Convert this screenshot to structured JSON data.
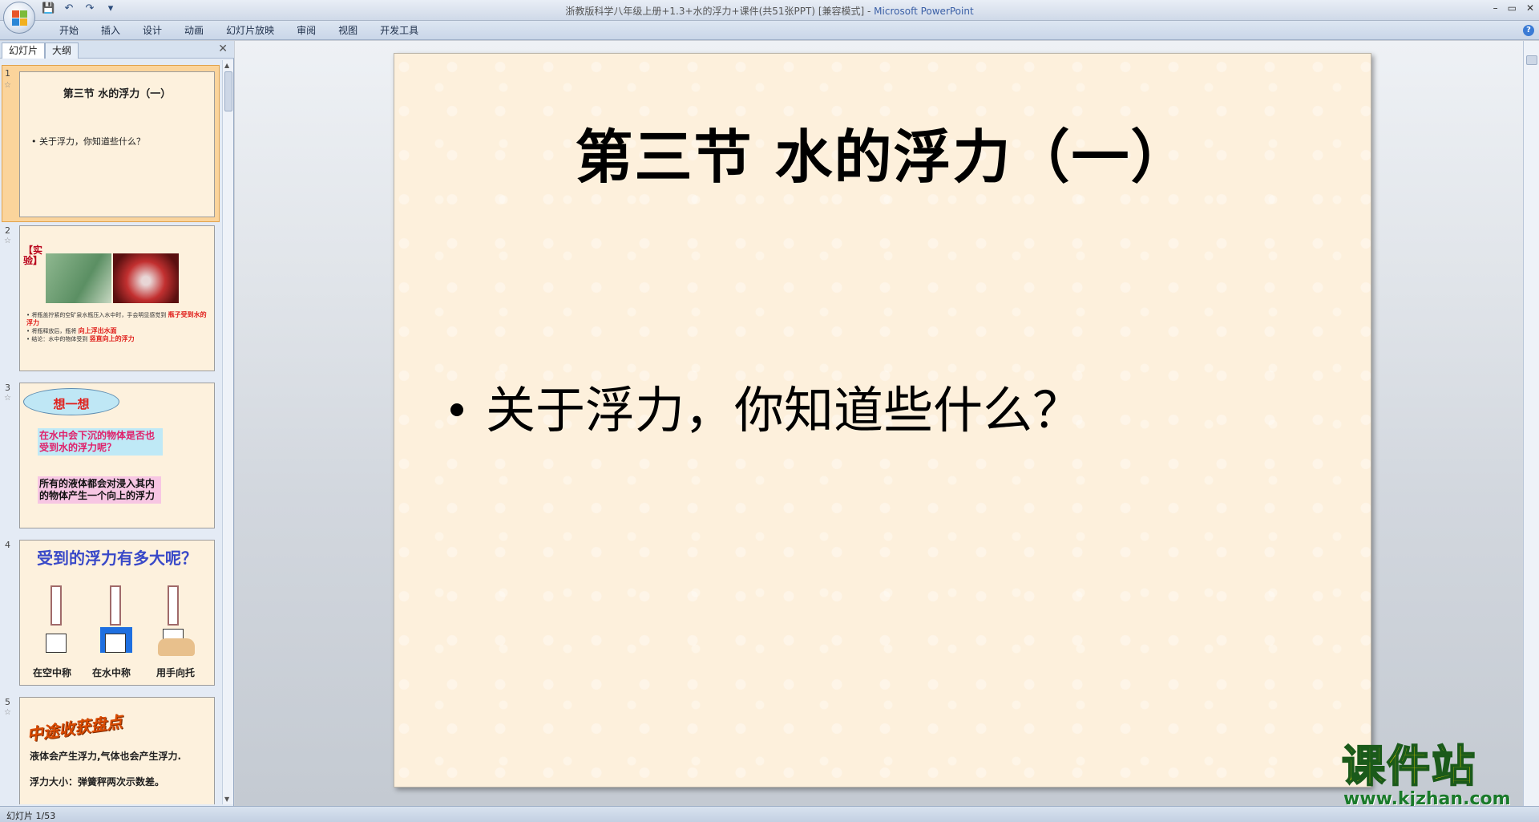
{
  "window": {
    "title": "浙教版科学八年级上册+1.3+水的浮力+课件(共51张PPT) [兼容模式]",
    "app_name": "Microsoft PowerPoint",
    "controls": [
      "–",
      "▭",
      "✕"
    ]
  },
  "ribbon": {
    "tabs": [
      "开始",
      "插入",
      "设计",
      "动画",
      "幻灯片放映",
      "审阅",
      "视图",
      "开发工具"
    ]
  },
  "left_pane": {
    "tab_slides": "幻灯片",
    "tab_outline": "大纲",
    "close": "✕",
    "thumbnails": [
      {
        "num": "1",
        "title": "第三节 水的浮力（一）",
        "bullet": "• 关于浮力，你知道些什么？"
      },
      {
        "num": "2",
        "label": "【实验】",
        "line1": "• 将瓶盖拧紧的空矿泉水瓶压入水中时，手会明显感觉到",
        "fill1": "瓶子受到水的浮力",
        "line2": "• 将瓶释放后，瓶将",
        "fill2": "向上浮出水面",
        "line3": "• 结论：水中的物体受到",
        "fill3": "竖直向上的浮力"
      },
      {
        "num": "3",
        "cloud": "想一想",
        "question": "在水中会下沉的物体是否也受到水的浮力呢？",
        "answer": "所有的液体都会对浸入其内的物体产生一个向上的浮力"
      },
      {
        "num": "4",
        "title": "受到的浮力有多大呢？",
        "captions": [
          "在空中称",
          "在水中称",
          "用手向托"
        ]
      },
      {
        "num": "5",
        "title": "中途收获盘点",
        "line1": "液体会产生浮力,气体也会产生浮力.",
        "line2": "浮力大小：弹簧秤两次示数差。"
      }
    ]
  },
  "slide": {
    "title": "第三节  水的浮力（一）",
    "bullet": "关于浮力，你知道些什么？"
  },
  "watermark": {
    "text": "课件站",
    "url": "www.kjzhan.com"
  },
  "status": {
    "slide_counter": "幻灯片 1/53"
  }
}
